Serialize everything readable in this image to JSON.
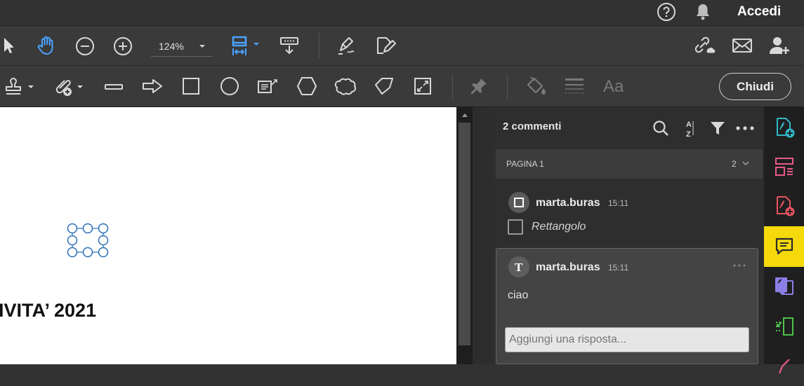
{
  "header": {
    "signin_label": "Accedi"
  },
  "toolbar": {
    "zoom_value": "124%",
    "close_label": "Chiudi"
  },
  "document": {
    "visible_heading": "IVITA’ 2021"
  },
  "comments_panel": {
    "count_label": "2 commenti",
    "page_group": {
      "label": "PAGINA 1",
      "count": "2"
    },
    "comments": [
      {
        "author": "marta.buras",
        "time": "15:11",
        "body": "Rettangolo",
        "type_icon": "rectangle-icon"
      },
      {
        "author": "marta.buras",
        "time": "15:11",
        "body": "ciao",
        "type_icon": "text-t-icon"
      }
    ],
    "reply_placeholder": "Aggiungi una risposta..."
  },
  "colors": {
    "accent_blue": "#4aa3ff",
    "active_rail": "#f5d90b",
    "panel_bg": "#2e2e2e",
    "toolbar_bg": "#3a3a3a"
  }
}
